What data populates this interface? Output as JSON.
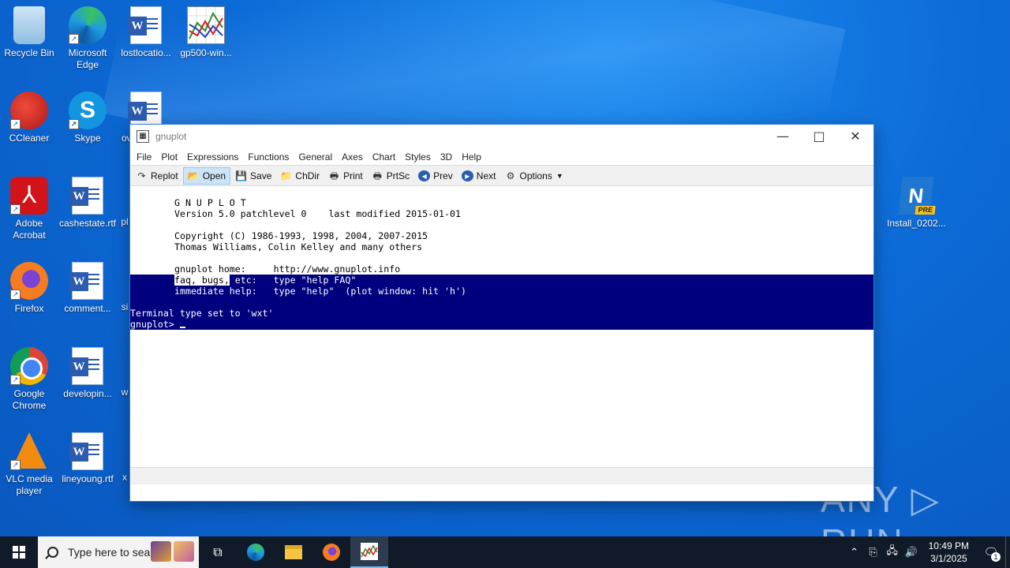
{
  "desktop": {
    "icons": [
      {
        "label": "Recycle Bin"
      },
      {
        "label": "Microsoft Edge"
      },
      {
        "label": "lostlocatio..."
      },
      {
        "label": "gp500-win..."
      },
      {
        "label": "CCleaner"
      },
      {
        "label": "Skype"
      },
      {
        "label": "ov"
      },
      {
        "label": "Adobe Acrobat"
      },
      {
        "label": "cashestate.rtf"
      },
      {
        "label": "pl"
      },
      {
        "label": "Firefox"
      },
      {
        "label": "comment..."
      },
      {
        "label": "si"
      },
      {
        "label": "Google Chrome"
      },
      {
        "label": "developin..."
      },
      {
        "label": "w"
      },
      {
        "label": "VLC media player"
      },
      {
        "label": "lineyoung.rtf"
      },
      {
        "label": "x"
      },
      {
        "label": "Install_0202..."
      }
    ],
    "onenote_badge": "PRE"
  },
  "window": {
    "title": "gnuplot",
    "menu": [
      "File",
      "Plot",
      "Expressions",
      "Functions",
      "General",
      "Axes",
      "Chart",
      "Styles",
      "3D",
      "Help"
    ],
    "toolbar": [
      {
        "label": "Replot",
        "icon": "replot-icon"
      },
      {
        "label": "Open",
        "icon": "open-folder-icon",
        "active": true
      },
      {
        "label": "Save",
        "icon": "floppy-icon"
      },
      {
        "label": "ChDir",
        "icon": "chdir-folder-icon"
      },
      {
        "label": "Print",
        "icon": "printer-icon"
      },
      {
        "label": "PrtSc",
        "icon": "printer-screen-icon"
      },
      {
        "label": "Prev",
        "icon": "back-arrow-icon"
      },
      {
        "label": "Next",
        "icon": "forward-arrow-icon"
      },
      {
        "label": "Options",
        "icon": "options-icon"
      }
    ],
    "console": {
      "banner_title": "G N U P L O T",
      "version": "Version 5.0 patchlevel 0    last modified 2015-01-01",
      "copyright": "Copyright (C) 1986-1993, 1998, 2004, 2007-2015",
      "authors": "Thomas Williams, Colin Kelley and many others",
      "home": "gnuplot home:     http://www.gnuplot.info",
      "faq_pre": "faq, bugs,",
      "faq_post": " etc:   type \"help FAQ\"",
      "immediate": "immediate help:   type \"help\"  (plot window: hit 'h')",
      "terminal": "Terminal type set to 'wxt'",
      "prompt": "gnuplot> "
    }
  },
  "watermark": "ANY ▷ RUN",
  "taskbar": {
    "search_placeholder": "Type here to search",
    "time": "10:49 PM",
    "date": "3/1/2025",
    "notification_count": "1"
  },
  "colors": {
    "selection": "#00007f",
    "taskbar": "#111a28",
    "desktop": "#0c6ad6"
  }
}
